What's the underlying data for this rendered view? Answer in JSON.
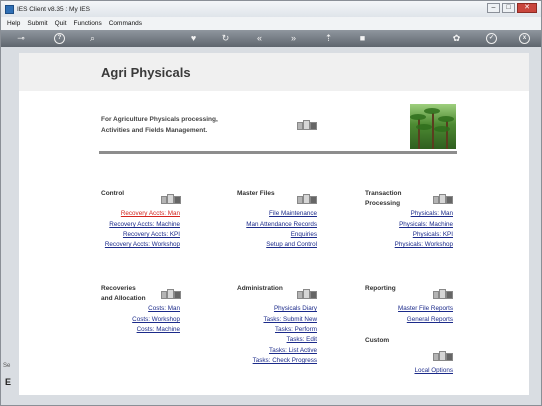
{
  "window": {
    "title": "IES Client v8.35 : My IES"
  },
  "menu": [
    "Help",
    "Submit",
    "Quit",
    "Functions",
    "Commands"
  ],
  "toolbar_icons": [
    "key-icon",
    "help-icon",
    "search-icon",
    "heart-icon",
    "refresh-icon",
    "rewind-icon",
    "fast-forward-icon",
    "upload-icon",
    "stop-icon",
    "settings-icon",
    "check-icon",
    "close-icon"
  ],
  "page": {
    "title": "Agri Physicals",
    "intro": [
      "For Agriculture Physicals processing,",
      "Activities and Fields Management."
    ]
  },
  "sections": {
    "control": {
      "title": "Control",
      "links": [
        "Recovery Accts: Man",
        "Recovery Accts: Machine",
        "Recovery Accts: KPI",
        "Recovery Accts: Workshop"
      ]
    },
    "master_files": {
      "title": "Master Files",
      "links": [
        "File Maintenance",
        "Man Attendance Records",
        "Enquiries",
        "Setup and Control"
      ]
    },
    "transaction": {
      "title": [
        "Transaction",
        "Processing"
      ],
      "links": [
        "Physicals: Man",
        "Physicals: Machine",
        "Physicals: KPI",
        "Physicals: Workshop"
      ]
    },
    "recoveries": {
      "title": [
        "Recoveries",
        "and Allocation"
      ],
      "links": [
        "Costs: Man",
        "Costs: Workshop",
        "Costs: Machine"
      ]
    },
    "administration": {
      "title": "Administration",
      "links": [
        "Physicals Diary",
        "Tasks: Submit New",
        "Tasks: Perform",
        "Tasks: Edit",
        "Tasks: List Active",
        "Tasks: Check Progress"
      ]
    },
    "reporting": {
      "title": "Reporting",
      "links": [
        "Master File Reports",
        "General Reports"
      ]
    },
    "custom": {
      "title": "Custom",
      "links": [
        "Local Options"
      ]
    }
  },
  "side_fragments": [
    "Se",
    "E"
  ],
  "colors": {
    "link": "#1b2a8a",
    "active_link": "#d4241d",
    "toolbar": "#6f767e"
  }
}
